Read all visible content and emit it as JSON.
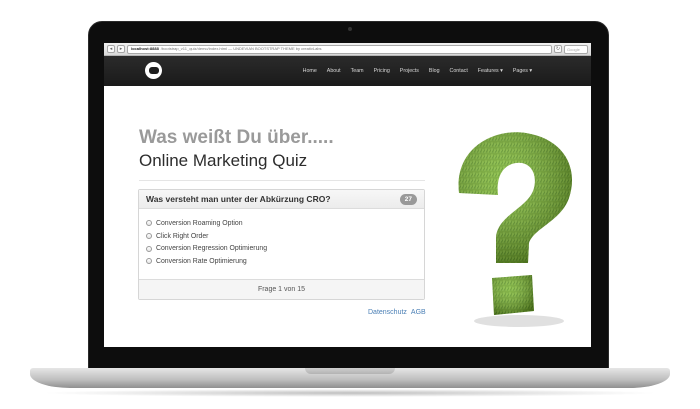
{
  "browser": {
    "back_label": "◂",
    "forward_label": "▸",
    "url_host": "localhost:8888",
    "url_path": "/bootstrap_v11_quiz/demo/index.html — UNDEVIAN BOOTSTRAP THEME by creativLabs",
    "search_placeholder": "Google",
    "refresh_label": "↻"
  },
  "navbar": {
    "items": [
      {
        "label": "Home"
      },
      {
        "label": "About"
      },
      {
        "label": "Team"
      },
      {
        "label": "Pricing"
      },
      {
        "label": "Projects"
      },
      {
        "label": "Blog"
      },
      {
        "label": "Contact"
      },
      {
        "label": "Features ▾"
      },
      {
        "label": "Pages ▾"
      }
    ]
  },
  "hero": {
    "title_1": "Was weißt Du über.....",
    "title_2": "Online Marketing Quiz"
  },
  "quiz": {
    "question": "Was versteht man unter der Abkürzung CRO?",
    "badge": "27",
    "answers": [
      {
        "label": "Conversion Roaming Option"
      },
      {
        "label": "Click Right Order"
      },
      {
        "label": "Conversion Regression Optimierung"
      },
      {
        "label": "Conversion Rate Optimierung"
      }
    ],
    "footer": "Frage 1 von 15"
  },
  "footer_links": {
    "privacy": "Datenschutz",
    "terms": "AGB"
  },
  "colors": {
    "accent_green": "#6fa829",
    "navbar": "#1f1f1f",
    "link": "#4a7fb5"
  }
}
